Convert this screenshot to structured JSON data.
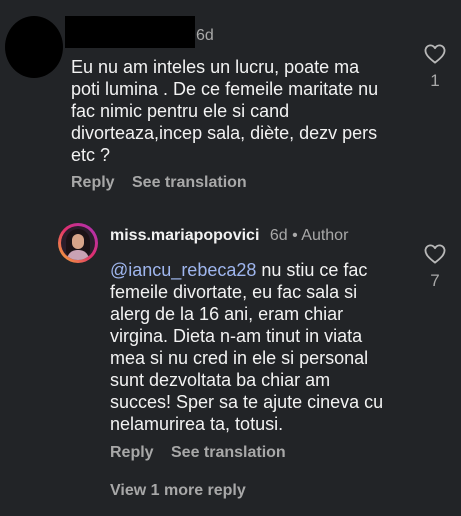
{
  "comment1": {
    "time": "6d",
    "text": "Eu nu am inteles un lucru, poate ma\npoti lumina . De ce femeile maritate nu\nfac nimic pentru ele si cand\ndivorteaza,incep sala, diète, dezv pers\netc ?",
    "reply_label": "Reply",
    "translate_label": "See translation",
    "like_count": "1"
  },
  "comment2": {
    "username": "miss.mariapopovici",
    "time": "6d",
    "separator": "•",
    "badge": "Author",
    "mention": "@iancu_rebeca28",
    "text_after_mention": " nu stiu ce fac\nfemeile divortate, eu fac sala si\nalerg de la 16 ani, eram chiar\nvirgina. Dieta n-am tinut in viata\nmea si nu cred in ele si personal\nsunt dezvoltata ba chiar am\nsucces! Sper sa te ajute cineva cu\nnelamurirea ta, totusi.",
    "reply_label": "Reply",
    "translate_label": "See translation",
    "like_count": "7"
  },
  "view_more": "View 1 more reply",
  "icons": {
    "like": "heart-outline-icon"
  },
  "colors": {
    "background": "#222427",
    "secondary_text": "#a8a8a8",
    "mention": "#9fb6ee"
  }
}
